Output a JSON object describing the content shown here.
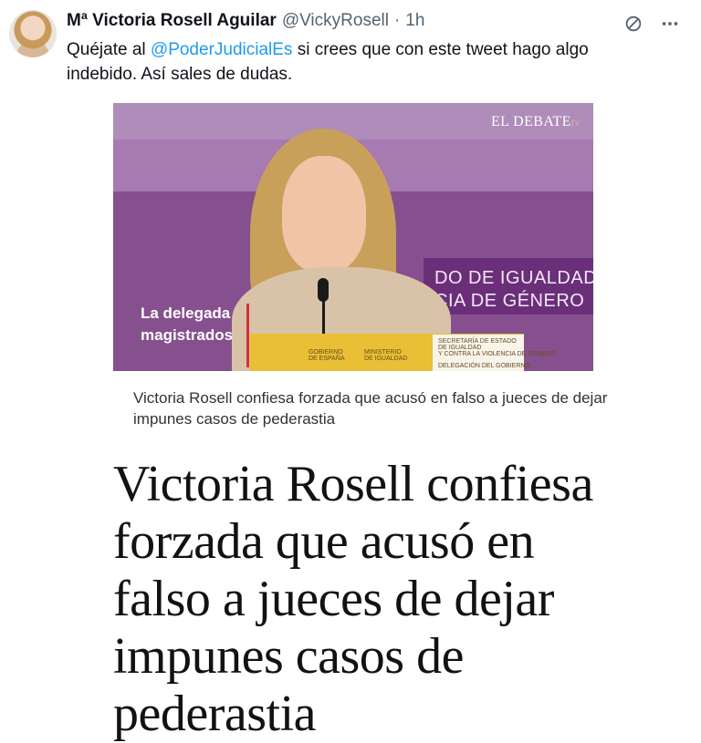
{
  "tweet": {
    "author_name": "Mª Victoria Rosell Aguilar",
    "handle": "@VickyRosell",
    "separator": "·",
    "time": "1h",
    "text_before": "Quéjate al ",
    "mention": "@PoderJudicialEs",
    "text_after": " si crees que con este tweet hago algo indebido. Así sales de dudas."
  },
  "actions": {
    "grok_icon": "grok-icon",
    "more_icon": "more-icon"
  },
  "media": {
    "brand": "EL DEBATE",
    "brand_suffix": "tv",
    "overlay_line1": "La delegada",
    "overlay_line2": "magistrados",
    "band_line1": "DO DE IGUALDAD",
    "band_line2": "CIA DE GÉNERO",
    "podium_left_line1": "GOBIERNO",
    "podium_left_line2": "DE ESPAÑA",
    "podium_mid_line1": "MINISTERIO",
    "podium_mid_line2": "DE IGUALDAD",
    "podium_right_line1": "SECRETARÍA DE ESTADO",
    "podium_right_line2": "DE IGUALDAD",
    "podium_right_line3": "Y CONTRA LA VIOLENCIA DE GÉNERO",
    "podium_footer": "DELEGACIÓN DEL GOBIERNO"
  },
  "caption": "Victoria Rosell confiesa forzada que acusó en falso a jueces de dejar impunes casos de pederastia",
  "headline": "Victoria Rosell confiesa forzada que acusó en falso a jueces de dejar impunes casos de pederastia",
  "colors": {
    "text": "#0f1419",
    "secondary": "#536471",
    "link": "#1d9bf0"
  }
}
